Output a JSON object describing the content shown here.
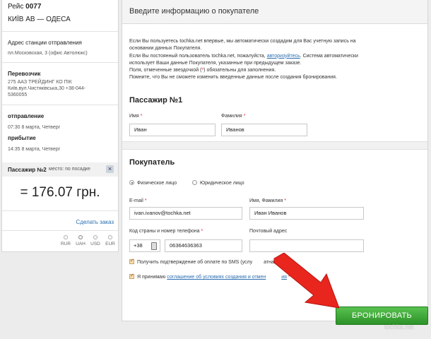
{
  "sidebar": {
    "trip_label": "Рейс",
    "trip_number": "0077",
    "route": "КИЇВ АВ — ОДЕСА",
    "departure_station_label": "Адрес станции отправления",
    "departure_station_address": "пл.Московская, 3 (офис Автолюкс)",
    "carrier_label": "Перевозчик",
    "carrier_name": "275 ААЗ ТРЕЙДИНГ КО ПІК",
    "carrier_address": "Київ,вул.Чистяківська,30 +38-044-",
    "carrier_phone_cont": "5360055",
    "departure_label": "отправление",
    "departure_time": "07:30 8 марта, Четверг",
    "arrival_label": "прибытие",
    "arrival_time": "14:35 8 марта, Четверг",
    "passenger_label": "Пассажир №2",
    "passenger_seat": "место: по посадке",
    "close_glyph": "×",
    "price": "= 176.07 грн.",
    "change_order": "Сделать заказ",
    "currencies": [
      "RUR",
      "UAH",
      "USD",
      "EUR"
    ],
    "selected_currency": "UAH"
  },
  "main": {
    "header_title": "Введите информацию о покупателе",
    "info": {
      "line1": "Если Вы пользуетесь tochka.net впервые, мы автоматически создадим для Вас учетную запись на",
      "line2": "основании данных Покупателя.",
      "line3_a": "Если Вы постоянный пользователь tochka.net, пожалуйста,",
      "line3_link": "авторизуйтесь",
      "line3_b": ". Система автоматически",
      "line4": "использует Ваши данные Покупателя, указанные при предыдущем заказе.",
      "line5_a": "Поля, отмеченные звездочкой (",
      "line5_star": "*",
      "line5_b": ") обязательны для заполнения.",
      "line6": "Помните, что Вы не сможете изменить введенные данные после создания бронирования."
    },
    "passenger": {
      "title": "Пассажир №1",
      "first_name_label": "Имя",
      "first_name_value": "Иван",
      "last_name_label": "Фамилия",
      "last_name_value": "Иванов"
    },
    "buyer": {
      "title": "Покупатель",
      "radio_individual": "Физическое лицо",
      "radio_legal": "Юридическое лицо",
      "email_label": "E-mail",
      "email_value": "ivan.ivanov@tochka.net",
      "fullname_label": "Имя, Фамилия",
      "fullname_value": "Иван Иванов",
      "phone_label": "Код страны и номер телефона",
      "country_code": "+38",
      "phone_value": "06364636363",
      "postal_label": "Почтовый адрес",
      "postal_value": "",
      "sms_checkbox": "Получить подтверждение об оплате по SMS (услу",
      "sms_checkbox_tail": "атная)",
      "terms_a": "Я принимаю",
      "terms_link": "соглашение об условиях создания и отмен",
      "terms_link_tail": "ия",
      "required_star": "*"
    },
    "book_button": "БРОНИРОВАТЬ"
  },
  "watermark": "tochka.net",
  "colors": {
    "link": "#2a6db0",
    "required": "#dd2222",
    "button_green": "#3ea83a",
    "arrow_red": "#e8261e"
  }
}
